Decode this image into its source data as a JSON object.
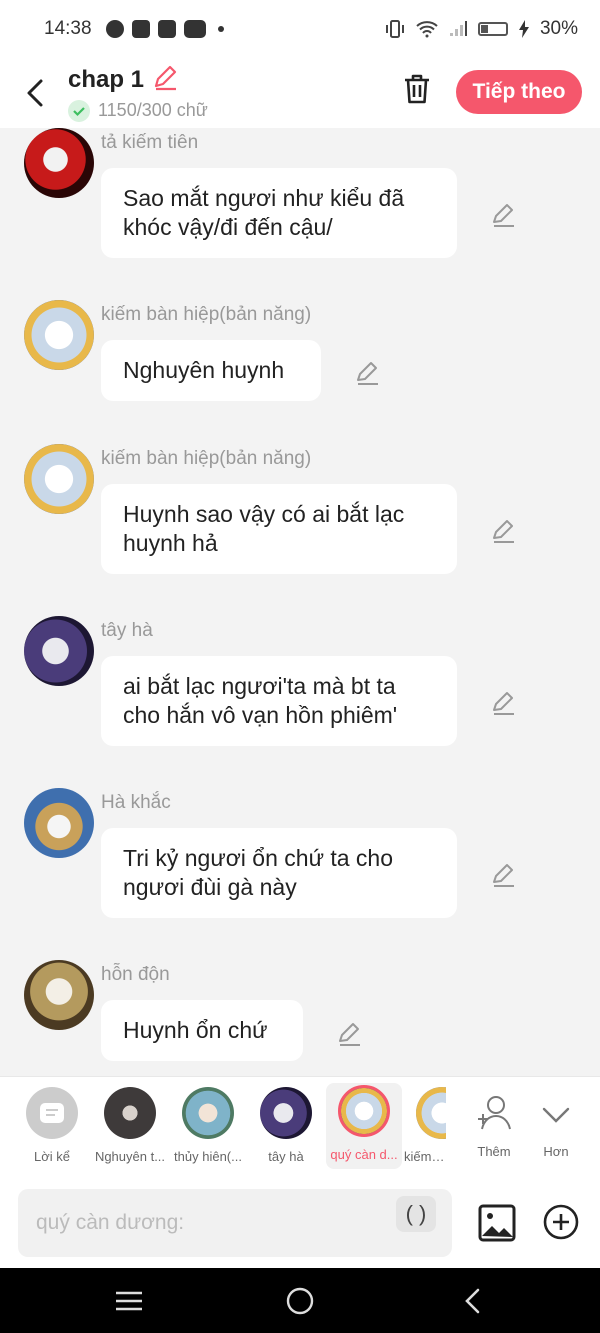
{
  "status_bar": {
    "time": "14:38",
    "battery": "30%",
    "battery_level": 0.3
  },
  "header": {
    "title": "chap 1",
    "word_count": "1150/300 chữ",
    "next_label": "Tiếp theo"
  },
  "messages": [
    {
      "sender": "tả kiếm tiên",
      "text": "Sao mắt ngươi như kiểu đã khóc vậy/đi đến cậu/"
    },
    {
      "sender": "kiếm bàn hiệp(bản năng)",
      "text": "Nghuyên huynh"
    },
    {
      "sender": "kiếm bàn hiệp(bản năng)",
      "text": "Huynh sao vậy có ai bắt lạc huynh hả"
    },
    {
      "sender": "tây hà",
      "text": "ai bắt lạc ngươi'ta mà bt ta cho hắn vô vạn hồn phiêm'"
    },
    {
      "sender": "Hà khắc",
      "text": "Tri kỷ ngươi ổn chứ ta cho ngươi đùi gà này"
    },
    {
      "sender": "hỗn độn",
      "text": "Huynh ổn chứ"
    }
  ],
  "strip": {
    "chips": [
      {
        "label": "Lời kể"
      },
      {
        "label": "Nghuyên t..."
      },
      {
        "label": "thủy hiên(..."
      },
      {
        "label": "tây hà"
      },
      {
        "label": "quý càn d..."
      },
      {
        "label": "kiếm b..."
      }
    ],
    "add_label": "Thêm",
    "more_label": "Hơn"
  },
  "input": {
    "placeholder": "quý càn dương:",
    "paren_label": "( )"
  }
}
